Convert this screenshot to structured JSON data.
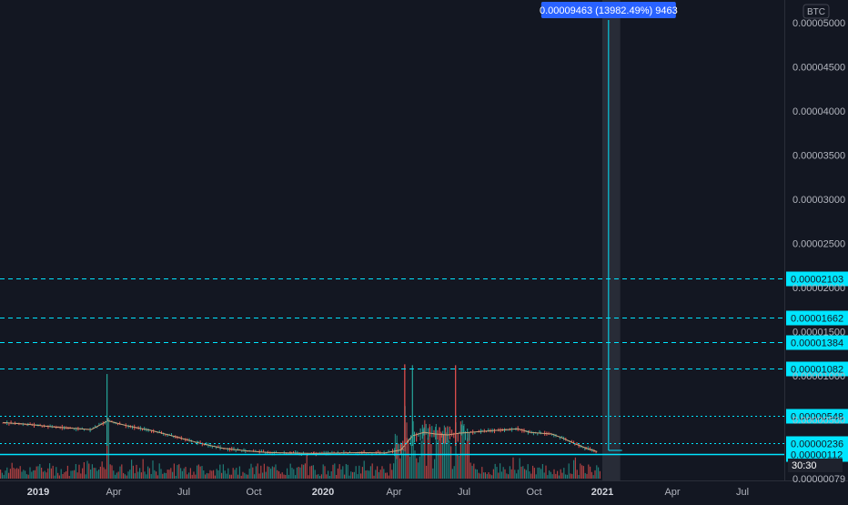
{
  "currency_label": "BTC",
  "countdown_label": "30:30",
  "measure_label": "0.00009463 (13982.49%) 9463",
  "colors": {
    "background": "#131722",
    "up": "#26a69a",
    "down": "#ef5350",
    "hline": "#00e5ff",
    "measure": "#2962ff",
    "text": "#b2b5be"
  },
  "chart_data": {
    "type": "candlestick",
    "y_axis": {
      "min": 7e-07,
      "max": 5.2e-06,
      "ticks": [
        "0.00005000",
        "0.00004500",
        "0.00004000",
        "0.00003500",
        "0.00003000",
        "0.00002500",
        "0.00002000",
        "0.00001500",
        "0.00001000",
        "0.00000500",
        "0.00000079"
      ],
      "tick_values": [
        5e-05,
        4.5e-05,
        4e-05,
        3.5e-05,
        3e-05,
        2.5e-05,
        2e-05,
        1.5e-05,
        1e-05,
        5e-06,
        7.9e-07
      ]
    },
    "x_axis": {
      "ticks": [
        {
          "label": "2019",
          "date": "2019-01-01",
          "bold": true
        },
        {
          "label": "Apr",
          "date": "2019-04-01",
          "bold": false
        },
        {
          "label": "Jul",
          "date": "2019-07-01",
          "bold": false
        },
        {
          "label": "Oct",
          "date": "2019-10-01",
          "bold": false
        },
        {
          "label": "2020",
          "date": "2020-01-01",
          "bold": true
        },
        {
          "label": "Apr",
          "date": "2020-04-01",
          "bold": false
        },
        {
          "label": "Jul",
          "date": "2020-07-01",
          "bold": false
        },
        {
          "label": "Oct",
          "date": "2020-10-01",
          "bold": false
        },
        {
          "label": "2021",
          "date": "2021-01-01",
          "bold": true
        },
        {
          "label": "Apr",
          "date": "2021-04-01",
          "bold": false
        },
        {
          "label": "Jul",
          "date": "2021-07-01",
          "bold": false
        }
      ]
    },
    "horizontal_lines": [
      {
        "label": "0.00002103",
        "value": 2.103e-05,
        "style": "dashed"
      },
      {
        "label": "0.00001662",
        "value": 1.662e-05,
        "style": "dashed"
      },
      {
        "label": "0.00001384",
        "value": 1.384e-05,
        "style": "dashed"
      },
      {
        "label": "0.00001082",
        "value": 1.082e-05,
        "style": "dashed"
      },
      {
        "label": "0.00000548",
        "value": 5.48e-06,
        "style": "dotted"
      },
      {
        "label": "0.00000236",
        "value": 2.36e-06,
        "style": "dotted"
      },
      {
        "label": "0.00000112",
        "value": 1.12e-06,
        "style": "solid"
      }
    ],
    "price_series": {
      "dates": [
        "2018-11-20",
        "2018-12-20",
        "2019-01-20",
        "2019-02-20",
        "2019-03-05",
        "2019-03-25",
        "2019-04-20",
        "2019-05-20",
        "2019-06-20",
        "2019-07-20",
        "2019-08-20",
        "2019-09-20",
        "2019-10-20",
        "2019-11-20",
        "2019-12-20",
        "2020-01-20",
        "2020-02-20",
        "2020-03-20",
        "2020-04-10",
        "2020-04-25",
        "2020-05-10",
        "2020-05-25",
        "2020-06-10",
        "2020-06-25",
        "2020-07-10",
        "2020-07-25",
        "2020-08-10",
        "2020-08-25",
        "2020-09-10",
        "2020-09-25",
        "2020-10-10",
        "2020-10-25",
        "2020-11-10",
        "2020-11-25",
        "2020-12-10",
        "2020-12-25"
      ],
      "values": [
        4.7e-06,
        4.5e-06,
        4.2e-06,
        4e-06,
        3.9e-06,
        4.9e-06,
        4.3e-06,
        3.8e-06,
        3.1e-06,
        2.4e-06,
        1.8e-06,
        1.5e-06,
        1.3e-06,
        1.25e-06,
        1.2e-06,
        1.25e-06,
        1.3e-06,
        1.25e-06,
        1.6e-06,
        3.2e-06,
        3.6e-06,
        3.4e-06,
        3.3e-06,
        3.5e-06,
        3.6e-06,
        3.7e-06,
        3.8e-06,
        3.9e-06,
        4e-06,
        3.6e-06,
        3.5e-06,
        3.4e-06,
        2.9e-06,
        2.3e-06,
        1.8e-06,
        1.4e-06
      ]
    },
    "spikes": [
      {
        "date": "2019-03-24",
        "high": 1.02e-05
      },
      {
        "date": "2020-04-15",
        "high": 1.13e-05
      },
      {
        "date": "2020-04-25",
        "high": 1.12e-05
      },
      {
        "date": "2020-06-20",
        "high": 1.12e-05
      }
    ],
    "measure_range": {
      "start": "2021-01-01",
      "end": "2021-01-24",
      "marker": "2021-01-09"
    }
  }
}
